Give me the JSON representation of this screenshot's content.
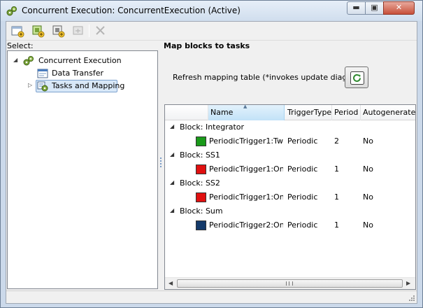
{
  "window": {
    "title": "Concurrent Execution: ConcurrentExecution (Active)",
    "icons": {
      "app": "gear-cluster-icon",
      "minimize": "minimize-icon",
      "maximize": "maximize-icon",
      "close": "close-icon"
    }
  },
  "toolbar": {
    "buttons": [
      {
        "icon": "add-configuration-icon"
      },
      {
        "icon": "add-task-group-icon"
      },
      {
        "icon": "add-task-icon"
      },
      {
        "icon": "add-trigger-icon",
        "disabled": true
      },
      {
        "icon": "delete-icon",
        "disabled": true
      }
    ]
  },
  "left": {
    "header": "Select:",
    "tree": [
      {
        "label": "Concurrent Execution",
        "icon": "gear-cluster-icon",
        "expanded": true
      },
      {
        "label": "Data Transfer",
        "icon": "data-transfer-icon"
      },
      {
        "label": "Tasks and Mapping",
        "icon": "task-mapping-icon",
        "selected": true,
        "collapsed": true
      }
    ]
  },
  "right": {
    "title": "Map blocks to tasks",
    "refresh_label": "Refresh mapping table (*invokes update diagram)",
    "refresh_icon": "refresh-icon",
    "table": {
      "columns": [
        "Name",
        "TriggerType",
        "Period",
        "Autogenerated"
      ],
      "sorted_column": "Name",
      "groups": [
        {
          "label": "Block: Integrator",
          "rows": [
            {
              "color": "#1a9a1a",
              "name": "PeriodicTrigger1:Tw...",
              "trigger": "Periodic",
              "period": "2",
              "auto": "No"
            }
          ]
        },
        {
          "label": "Block: SS1",
          "rows": [
            {
              "color": "#e01010",
              "name": "PeriodicTrigger1:On...",
              "trigger": "Periodic",
              "period": "1",
              "auto": "No"
            }
          ]
        },
        {
          "label": "Block: SS2",
          "rows": [
            {
              "color": "#e01010",
              "name": "PeriodicTrigger1:On...",
              "trigger": "Periodic",
              "period": "1",
              "auto": "No"
            }
          ]
        },
        {
          "label": "Block: Sum",
          "rows": [
            {
              "color": "#143a6a",
              "name": "PeriodicTrigger2:On...",
              "trigger": "Periodic",
              "period": "1",
              "auto": "No"
            }
          ]
        }
      ]
    }
  }
}
